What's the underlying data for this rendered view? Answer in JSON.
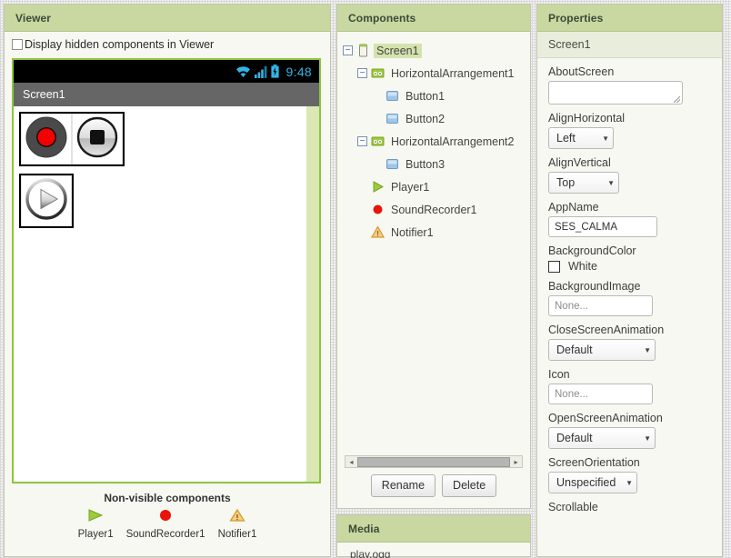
{
  "viewer": {
    "title": "Viewer",
    "hidden_checkbox_label": "Display hidden components in Viewer",
    "status_bar": {
      "time": "9:48",
      "wifi_icon": "wifi-icon",
      "signal_icon": "signal-bars-icon",
      "battery_icon": "battery-charging-icon"
    },
    "screen_title": "Screen1",
    "buttons": [
      {
        "name": "Button1",
        "icon": "record-button-icon"
      },
      {
        "name": "Button2",
        "icon": "stop-button-icon"
      },
      {
        "name": "Button3",
        "icon": "play-button-icon"
      }
    ],
    "nonvisible": {
      "title": "Non-visible components",
      "items": [
        {
          "label": "Player1",
          "icon": "player-triangle-icon"
        },
        {
          "label": "SoundRecorder1",
          "icon": "red-dot-recorder-icon"
        },
        {
          "label": "Notifier1",
          "icon": "warning-triangle-icon"
        }
      ]
    }
  },
  "components": {
    "title": "Components",
    "tree": [
      {
        "label": "Screen1",
        "indent": 1,
        "toggle": "−",
        "icon": "screen-icon",
        "selected": true
      },
      {
        "label": "HorizontalArrangement1",
        "indent": 2,
        "toggle": "−",
        "icon": "horizontal-arrangement-icon",
        "selected": false
      },
      {
        "label": "Button1",
        "indent": 3,
        "toggle": "",
        "icon": "button-icon",
        "selected": false
      },
      {
        "label": "Button2",
        "indent": 3,
        "toggle": "",
        "icon": "button-icon",
        "selected": false
      },
      {
        "label": "HorizontalArrangement2",
        "indent": 2,
        "toggle": "−",
        "icon": "horizontal-arrangement-icon",
        "selected": false
      },
      {
        "label": "Button3",
        "indent": 3,
        "toggle": "",
        "icon": "button-icon",
        "selected": false
      },
      {
        "label": "Player1",
        "indent": 2,
        "toggle": "",
        "icon": "player-triangle-icon",
        "selected": false
      },
      {
        "label": "SoundRecorder1",
        "indent": 2,
        "toggle": "",
        "icon": "red-dot-recorder-icon",
        "selected": false
      },
      {
        "label": "Notifier1",
        "indent": 2,
        "toggle": "",
        "icon": "warning-triangle-icon",
        "selected": false
      }
    ],
    "scroll_left_arrow": "◂",
    "scroll_right_arrow": "▸",
    "rename_label": "Rename",
    "delete_label": "Delete"
  },
  "media": {
    "title": "Media",
    "items": [
      {
        "label": "play.ogg"
      }
    ]
  },
  "properties": {
    "title": "Properties",
    "component_name": "Screen1",
    "fields": [
      {
        "label": "AboutScreen",
        "type": "textarea",
        "value": ""
      },
      {
        "label": "AlignHorizontal",
        "type": "select",
        "value": "Left"
      },
      {
        "label": "AlignVertical",
        "type": "select",
        "value": "Top"
      },
      {
        "label": "AppName",
        "type": "input",
        "value": "SES_CALMA"
      },
      {
        "label": "BackgroundColor",
        "type": "color",
        "value": "White",
        "swatch": "#ffffff"
      },
      {
        "label": "BackgroundImage",
        "type": "input",
        "value": "None..."
      },
      {
        "label": "CloseScreenAnimation",
        "type": "select",
        "value": "Default"
      },
      {
        "label": "Icon",
        "type": "input",
        "value": "None..."
      },
      {
        "label": "OpenScreenAnimation",
        "type": "select",
        "value": "Default"
      },
      {
        "label": "ScreenOrientation",
        "type": "select",
        "value": "Unspecified"
      },
      {
        "label": "Scrollable",
        "type": "label-only",
        "value": ""
      }
    ],
    "caret_icon": "chevron-down-icon"
  },
  "colors": {
    "header_green": "#c8d8a0",
    "panel_bg": "#f7f8f1",
    "phone_border_green": "#8cc63e",
    "status_blue": "#33b5e5",
    "title_bar_gray": "#666666",
    "selected_node": "#d4e3ae"
  }
}
